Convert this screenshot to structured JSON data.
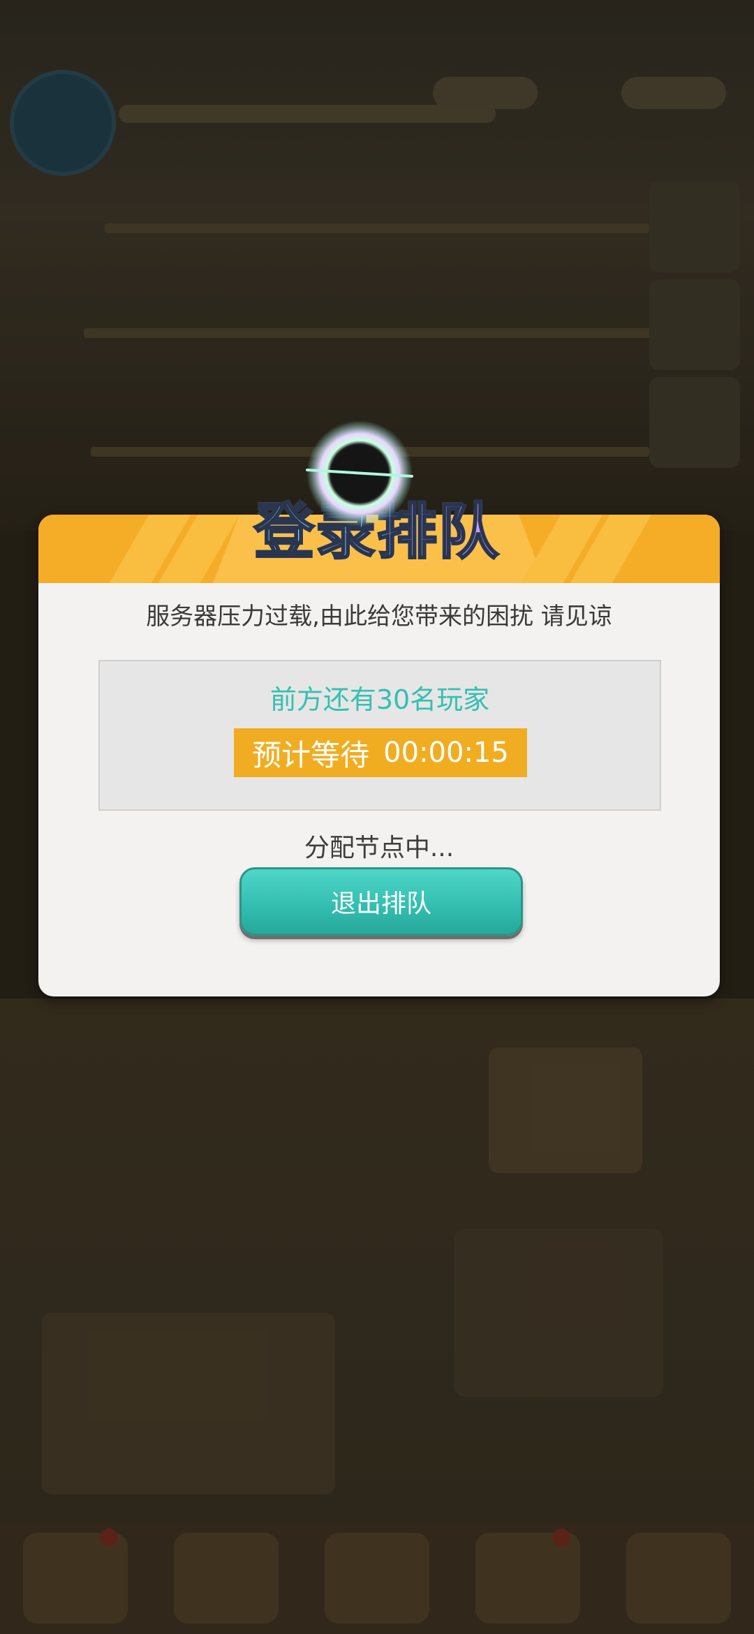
{
  "dialog": {
    "title": "登录排队",
    "message": "服务器压力过载,由此给您带来的困扰 请见谅",
    "queue_info": "前方还有30名玩家",
    "wait_label": "预计等待",
    "wait_time": "00:00:15",
    "status": "分配节点中...",
    "exit_button": "退出排队"
  },
  "colors": {
    "header": "#f5ad28",
    "accent_teal": "#36bfb2",
    "wait_pill": "#f1ad22",
    "dialog_bg": "#f3f2f0"
  },
  "icons": {
    "title_orb": "loading-orb-icon"
  }
}
